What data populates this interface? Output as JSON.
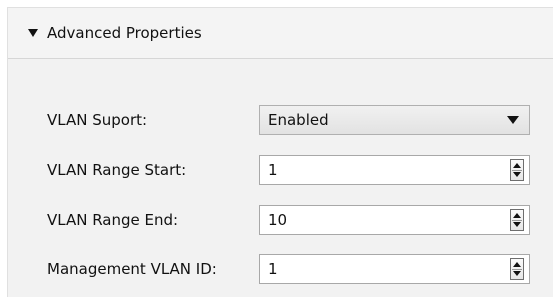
{
  "section": {
    "title": "Advanced Properties",
    "expanded": true,
    "toggle_icon": "triangle-down-icon"
  },
  "fields": {
    "vlan_support": {
      "label": "VLAN Suport:",
      "value": "Enabled",
      "control": "dropdown"
    },
    "vlan_range_start": {
      "label": "VLAN Range Start:",
      "value": "1",
      "control": "spinbox"
    },
    "vlan_range_end": {
      "label": "VLAN Range End:",
      "value": "10",
      "control": "spinbox"
    },
    "management_vlan_id": {
      "label": "Management VLAN ID:",
      "value": "1",
      "control": "spinbox"
    }
  },
  "colors": {
    "panel_background": "#f2f2f2",
    "field_background": "#ffffff",
    "field_border": "#a8a8a8"
  }
}
